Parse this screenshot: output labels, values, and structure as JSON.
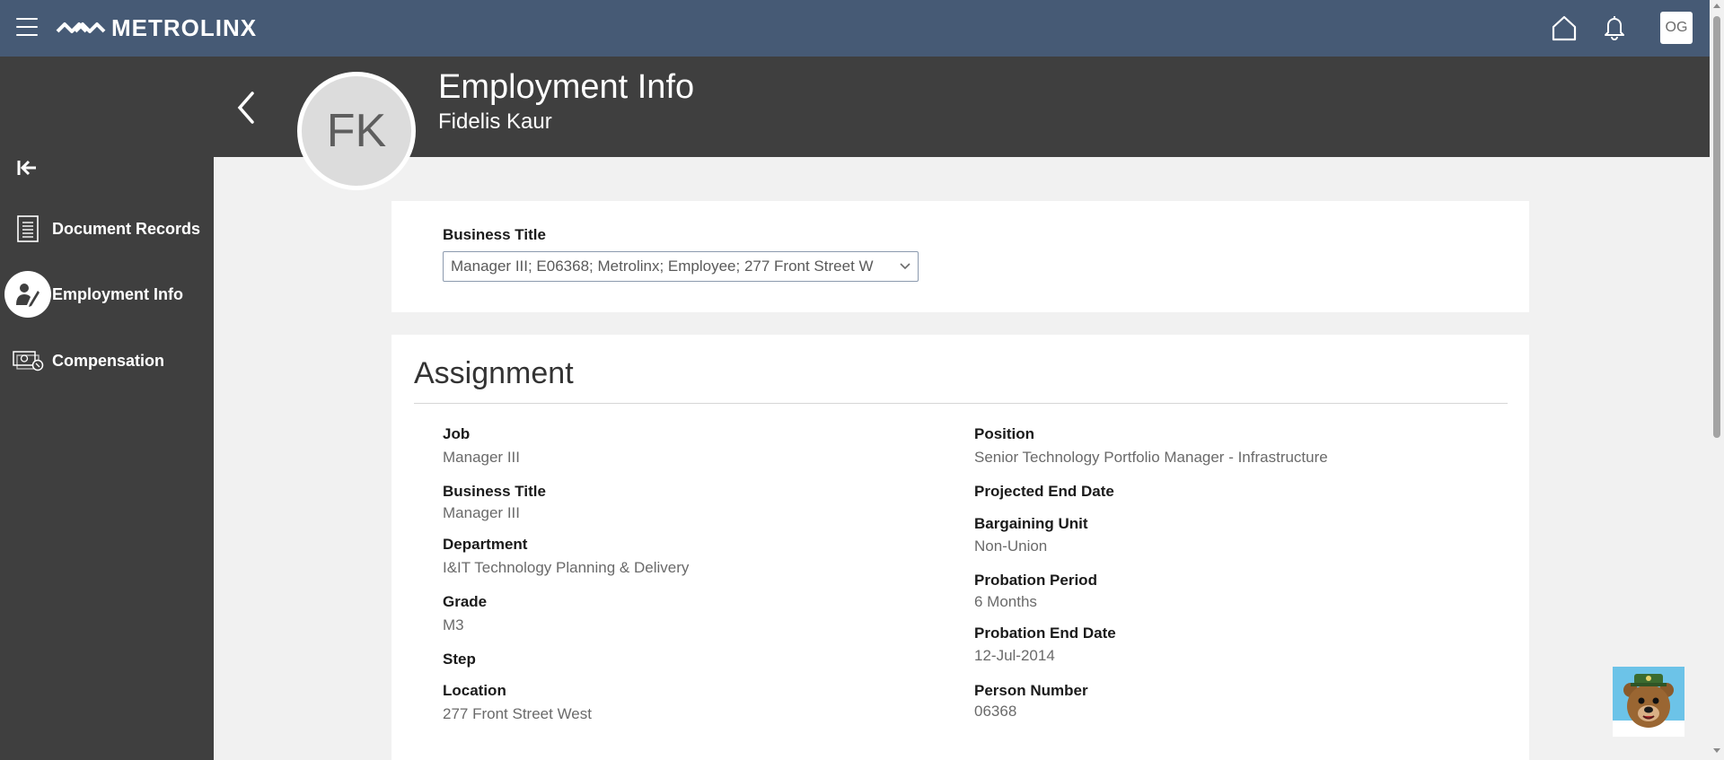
{
  "topbar": {
    "logo_text": "METROLINX",
    "user_initials": "OG"
  },
  "sidebar": {
    "items": [
      {
        "label": "Document Records"
      },
      {
        "label": "Employment Info"
      },
      {
        "label": "Compensation"
      }
    ]
  },
  "header": {
    "title": "Employment Info",
    "subtitle": "Fidelis Kaur",
    "avatar_initials": "FK"
  },
  "business": {
    "label": "Business Title",
    "selected": "Manager III; E06368; Metrolinx; Employee; 277 Front Street W"
  },
  "assignment": {
    "title": "Assignment",
    "left": [
      {
        "label": "Job",
        "value": "Manager III"
      },
      {
        "label": "Business Title",
        "value": "Manager III"
      },
      {
        "label": "Department",
        "value": "I&IT Technology Planning & Delivery"
      },
      {
        "label": "Grade",
        "value": "M3"
      },
      {
        "label": "Step",
        "value": ""
      },
      {
        "label": "Location",
        "value": "277 Front Street West"
      }
    ],
    "right": [
      {
        "label": "Position",
        "value": "Senior Technology Portfolio Manager - Infrastructure"
      },
      {
        "label": "Projected End Date",
        "value": ""
      },
      {
        "label": "Bargaining Unit",
        "value": "Non-Union"
      },
      {
        "label": "Probation Period",
        "value": "6 Months"
      },
      {
        "label": "Probation End Date",
        "value": "12-Jul-2014"
      },
      {
        "label": "Person Number",
        "value": "06368"
      }
    ]
  },
  "colors": {
    "topbar": "#465a75",
    "sidebar": "#3f3f3f",
    "content_bg": "#f1f1f1"
  }
}
